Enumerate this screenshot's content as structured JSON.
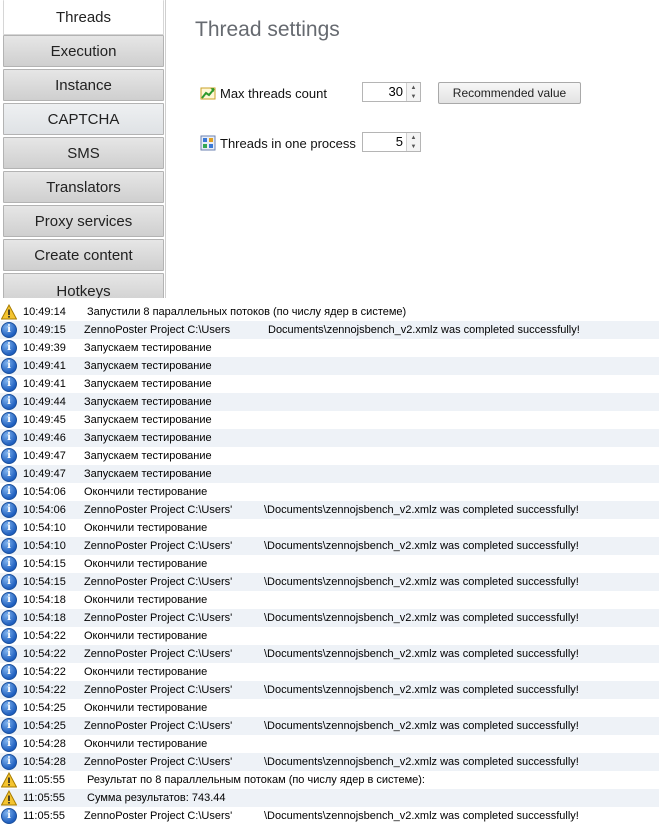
{
  "sidebar": {
    "items": [
      {
        "label": "Threads",
        "active": true
      },
      {
        "label": "Execution"
      },
      {
        "label": "Instance"
      },
      {
        "label": "CAPTCHA"
      },
      {
        "label": "SMS"
      },
      {
        "label": "Translators"
      },
      {
        "label": "Proxy services"
      },
      {
        "label": "Create content"
      },
      {
        "label": "Hotkeys"
      }
    ]
  },
  "settings": {
    "title": "Thread settings",
    "max_threads": {
      "label": "Max threads count",
      "value": "30",
      "icon": "chart-up-icon"
    },
    "threads_per_process": {
      "label": "Threads in one process",
      "value": "5",
      "icon": "grid-icon"
    },
    "recommended_button": "Recommended value"
  },
  "log": {
    "rows": [
      {
        "type": "warning",
        "time": "10:49:14",
        "msg": "Запустили 8 параллельных потоков (по числу ядер в системе)"
      },
      {
        "type": "info",
        "time": "10:49:15",
        "msg": "ZennoPoster Project C:\\Users",
        "path_end": "Documents\\zennojsbench_v2.xmlz was completed successfully!"
      },
      {
        "type": "info",
        "time": "10:49:39",
        "msg": "Запускаем тестирование"
      },
      {
        "type": "info",
        "time": "10:49:41",
        "msg": "Запускаем тестирование"
      },
      {
        "type": "info",
        "time": "10:49:41",
        "msg": "Запускаем тестирование"
      },
      {
        "type": "info",
        "time": "10:49:44",
        "msg": "Запускаем тестирование"
      },
      {
        "type": "info",
        "time": "10:49:45",
        "msg": "Запускаем тестирование"
      },
      {
        "type": "info",
        "time": "10:49:46",
        "msg": "Запускаем тестирование"
      },
      {
        "type": "info",
        "time": "10:49:47",
        "msg": "Запускаем тестирование"
      },
      {
        "type": "info",
        "time": "10:49:47",
        "msg": "Запускаем тестирование"
      },
      {
        "type": "info",
        "time": "10:54:06",
        "msg": "Окончили тестирование"
      },
      {
        "type": "info",
        "time": "10:54:06",
        "msg": "ZennoPoster Project C:\\Users'",
        "path_end": "\\Documents\\zennojsbench_v2.xmlz was completed successfully!"
      },
      {
        "type": "info",
        "time": "10:54:10",
        "msg": "Окончили тестирование"
      },
      {
        "type": "info",
        "time": "10:54:10",
        "msg": "ZennoPoster Project C:\\Users'",
        "path_end": "\\Documents\\zennojsbench_v2.xmlz was completed successfully!"
      },
      {
        "type": "info",
        "time": "10:54:15",
        "msg": "Окончили тестирование"
      },
      {
        "type": "info",
        "time": "10:54:15",
        "msg": "ZennoPoster Project C:\\Users'",
        "path_end": "\\Documents\\zennojsbench_v2.xmlz was completed successfully!"
      },
      {
        "type": "info",
        "time": "10:54:18",
        "msg": "Окончили тестирование"
      },
      {
        "type": "info",
        "time": "10:54:18",
        "msg": "ZennoPoster Project C:\\Users'",
        "path_end": "\\Documents\\zennojsbench_v2.xmlz was completed successfully!"
      },
      {
        "type": "info",
        "time": "10:54:22",
        "msg": "Окончили тестирование"
      },
      {
        "type": "info",
        "time": "10:54:22",
        "msg": "ZennoPoster Project C:\\Users'",
        "path_end": "\\Documents\\zennojsbench_v2.xmlz was completed successfully!"
      },
      {
        "type": "info",
        "time": "10:54:22",
        "msg": "Окончили тестирование"
      },
      {
        "type": "info",
        "time": "10:54:22",
        "msg": "ZennoPoster Project C:\\Users'",
        "path_end": "\\Documents\\zennojsbench_v2.xmlz was completed successfully!"
      },
      {
        "type": "info",
        "time": "10:54:25",
        "msg": "Окончили тестирование"
      },
      {
        "type": "info",
        "time": "10:54:25",
        "msg": "ZennoPoster Project C:\\Users'",
        "path_end": "\\Documents\\zennojsbench_v2.xmlz was completed successfully!"
      },
      {
        "type": "info",
        "time": "10:54:28",
        "msg": "Окончили тестирование"
      },
      {
        "type": "info",
        "time": "10:54:28",
        "msg": "ZennoPoster Project C:\\Users'",
        "path_end": "\\Documents\\zennojsbench_v2.xmlz was completed successfully!"
      },
      {
        "type": "warning",
        "time": "11:05:55",
        "msg": "Результат по 8 параллельным потокам (по числу ядер в системе):"
      },
      {
        "type": "warning",
        "time": "11:05:55",
        "msg": "Сумма результатов: 743.44"
      },
      {
        "type": "info",
        "time": "11:05:55",
        "msg": "ZennoPoster Project C:\\Users'",
        "path_end": "\\Documents\\zennojsbench_v2.xmlz was completed successfully!"
      }
    ]
  }
}
